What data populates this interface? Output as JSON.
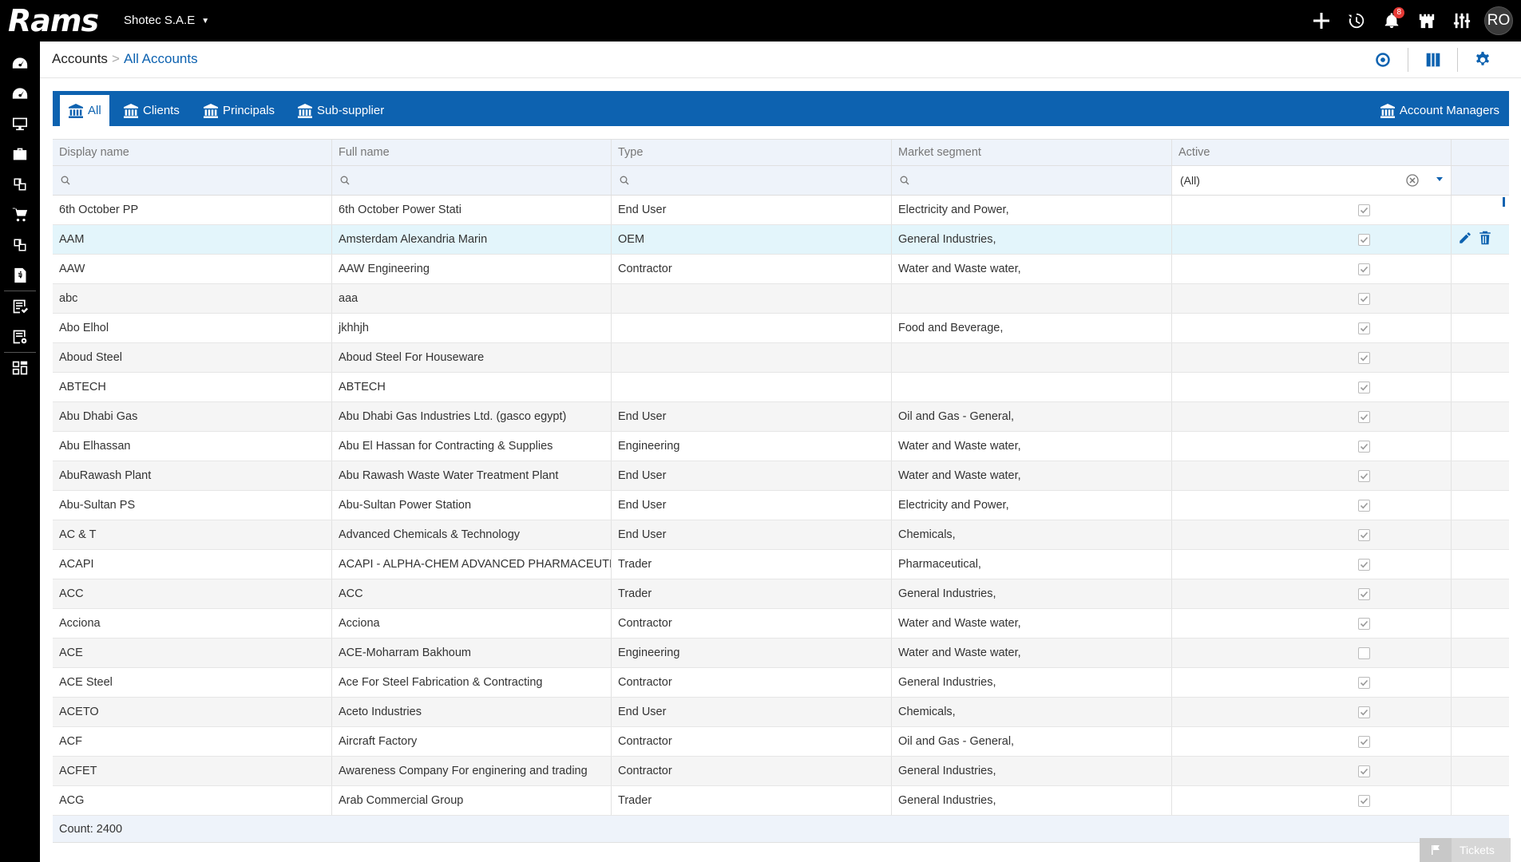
{
  "app": {
    "logo": "Rams",
    "company": "Shotec S.A.E",
    "notifications_count": "8",
    "avatar_initials": "RO"
  },
  "breadcrumb": {
    "root": "Accounts",
    "separator": ">",
    "current": "All Accounts"
  },
  "tabs": [
    {
      "label": "All",
      "active": true
    },
    {
      "label": "Clients"
    },
    {
      "label": "Principals"
    },
    {
      "label": "Sub-supplier"
    },
    {
      "label": "Account Managers"
    }
  ],
  "columns": [
    "Display name",
    "Full name",
    "Type",
    "Market segment",
    "Active"
  ],
  "filters": {
    "active_value": "(All)"
  },
  "rows": [
    {
      "display": "6th October PP",
      "full": "6th October Power Stati",
      "type": "End User",
      "segment": "Electricity and Power,",
      "active": true
    },
    {
      "display": "AAM",
      "full": "Amsterdam Alexandria Marin",
      "type": "OEM",
      "segment": "General Industries,",
      "active": true
    },
    {
      "display": "AAW",
      "full": "AAW Engineering",
      "type": "Contractor",
      "segment": "Water and Waste water,",
      "active": true
    },
    {
      "display": "abc",
      "full": "aaa",
      "type": "",
      "segment": "",
      "active": true
    },
    {
      "display": "Abo Elhol",
      "full": "jkhhjh",
      "type": "",
      "segment": "Food and Beverage,",
      "active": true
    },
    {
      "display": "Aboud Steel",
      "full": "Aboud Steel For Houseware",
      "type": "",
      "segment": "",
      "active": true
    },
    {
      "display": "ABTECH",
      "full": "ABTECH",
      "type": "",
      "segment": "",
      "active": true
    },
    {
      "display": "Abu Dhabi Gas",
      "full": "Abu Dhabi Gas Industries Ltd. (gasco egypt)",
      "type": "End User",
      "segment": "Oil and Gas - General,",
      "active": true
    },
    {
      "display": "Abu Elhassan",
      "full": "Abu El Hassan for Contracting & Supplies",
      "type": "Engineering",
      "segment": "Water and Waste water,",
      "active": true
    },
    {
      "display": "AbuRawash Plant",
      "full": "Abu Rawash Waste Water Treatment Plant",
      "type": "End User",
      "segment": "Water and Waste water,",
      "active": true
    },
    {
      "display": "Abu-Sultan PS",
      "full": "Abu-Sultan Power Station",
      "type": "End User",
      "segment": "Electricity and Power,",
      "active": true
    },
    {
      "display": "AC & T",
      "full": "Advanced Chemicals & Technology",
      "type": "End User",
      "segment": "Chemicals,",
      "active": true
    },
    {
      "display": "ACAPI",
      "full": "ACAPI - ALPHA-CHEM ADVANCED PHARMACEUTIC...",
      "type": "Trader",
      "segment": "Pharmaceutical,",
      "active": true
    },
    {
      "display": "ACC",
      "full": "ACC",
      "type": "Trader",
      "segment": "General Industries,",
      "active": true
    },
    {
      "display": "Acciona",
      "full": "Acciona",
      "type": "Contractor",
      "segment": "Water and Waste water,",
      "active": true
    },
    {
      "display": "ACE",
      "full": "ACE-Moharram Bakhoum",
      "type": "Engineering",
      "segment": "Water and Waste water,",
      "active": false
    },
    {
      "display": "ACE Steel",
      "full": "Ace For Steel Fabrication & Contracting",
      "type": "Contractor",
      "segment": "General Industries,",
      "active": true
    },
    {
      "display": "ACETO",
      "full": "Aceto Industries",
      "type": "End User",
      "segment": "Chemicals,",
      "active": true
    },
    {
      "display": "ACF",
      "full": "Aircraft Factory",
      "type": "Contractor",
      "segment": "Oil and Gas - General,",
      "active": true
    },
    {
      "display": "ACFET",
      "full": "Awareness Company For enginering and trading",
      "type": "Contractor",
      "segment": "General Industries,",
      "active": true
    },
    {
      "display": "ACG",
      "full": "Arab Commercial Group",
      "type": "Trader",
      "segment": "General Industries,",
      "active": true
    }
  ],
  "footer": {
    "count_label": "Count: 2400"
  },
  "tickets": {
    "label": "Tickets"
  },
  "colors": {
    "brand": "#0d62b0",
    "topbar": "#000000",
    "highlight_row": "#e3f5fb",
    "badge": "#e53935"
  }
}
